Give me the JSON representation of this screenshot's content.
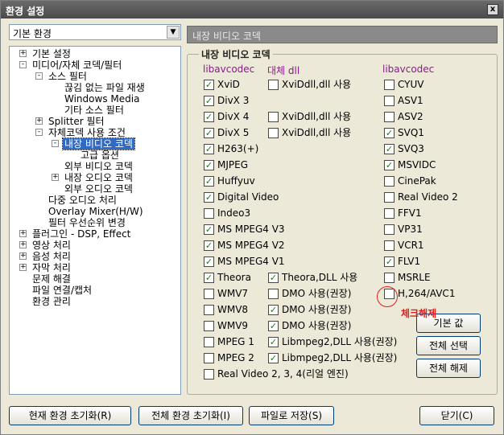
{
  "window": {
    "title": "환경 설정",
    "close_glyph": "x"
  },
  "combo": {
    "value": "기본 환경",
    "arrow_glyph": "▼"
  },
  "tree": [
    {
      "label": "기본 설정",
      "exp": "+"
    },
    {
      "label": "미디어/자체 코덱/필터",
      "exp": "-"
    },
    {
      "label": "소스 필터",
      "exp": "-"
    },
    {
      "label": "끊김 없는 파일 재생",
      "exp": ""
    },
    {
      "label": "Windows Media",
      "exp": ""
    },
    {
      "label": "기타 소스 필터",
      "exp": ""
    },
    {
      "label": "Splitter 필터",
      "exp": "+"
    },
    {
      "label": "자체코덱 사용 조건",
      "exp": "-"
    },
    {
      "label": "내장 비디오 코덱",
      "exp": "-"
    },
    {
      "label": "고급 옵션",
      "exp": ""
    },
    {
      "label": "외부 비디오 코덱",
      "exp": ""
    },
    {
      "label": "내장 오디오 코덱",
      "exp": "+"
    },
    {
      "label": "외부 오디오 코덱",
      "exp": ""
    },
    {
      "label": "다중 오디오 처리",
      "exp": ""
    },
    {
      "label": "Overlay Mixer(H/W)",
      "exp": ""
    },
    {
      "label": "필터 우선순위 변경",
      "exp": ""
    },
    {
      "label": "플러그인 - DSP, Effect",
      "exp": "+"
    },
    {
      "label": "영상 처리",
      "exp": "+"
    },
    {
      "label": "음성 처리",
      "exp": "+"
    },
    {
      "label": "자막 처리",
      "exp": "+"
    },
    {
      "label": "문제 해결",
      "exp": ""
    },
    {
      "label": "파일 연결/캡처",
      "exp": ""
    },
    {
      "label": "환경 관리",
      "exp": ""
    }
  ],
  "panel": {
    "header": "내장 비디오 코덱",
    "group_label": "내장 비디오 코덱",
    "col1_head": "libavcodec",
    "col2_head": "대체 dll",
    "col3_head": "libavcodec"
  },
  "col1": [
    {
      "label": "XviD",
      "checked": true
    },
    {
      "label": "DivX 3",
      "checked": true
    },
    {
      "label": "DivX 4",
      "checked": true
    },
    {
      "label": "DivX 5",
      "checked": true
    },
    {
      "label": "H263(+)",
      "checked": true
    },
    {
      "label": "MJPEG",
      "checked": true
    },
    {
      "label": "Huffyuv",
      "checked": true
    },
    {
      "label": "Digital Video",
      "checked": true
    },
    {
      "label": "Indeo3",
      "checked": false
    },
    {
      "label": "MS MPEG4 V3",
      "checked": true
    },
    {
      "label": "MS MPEG4 V2",
      "checked": true
    },
    {
      "label": "MS MPEG4 V1",
      "checked": true
    },
    {
      "label": "Theora",
      "checked": true
    },
    {
      "label": "WMV7",
      "checked": false
    },
    {
      "label": "WMV8",
      "checked": false
    },
    {
      "label": "WMV9",
      "checked": false
    },
    {
      "label": "MPEG 1",
      "checked": false
    },
    {
      "label": "MPEG 2",
      "checked": false
    },
    {
      "label": "Real Video 2, 3, 4(리얼 엔진)",
      "checked": false
    }
  ],
  "col2": [
    {
      "label": "XviDdll,dll 사용",
      "checked": false,
      "row": 0
    },
    {
      "label": "XviDdll,dll 사용",
      "checked": false,
      "row": 2
    },
    {
      "label": "XviDdll,dll 사용",
      "checked": false,
      "row": 3
    },
    {
      "label": "Theora,DLL 사용",
      "checked": true,
      "row": 12
    },
    {
      "label": "DMO 사용(권장)",
      "checked": false,
      "row": 13
    },
    {
      "label": "DMO 사용(권장)",
      "checked": true,
      "row": 14
    },
    {
      "label": "DMO 사용(권장)",
      "checked": true,
      "row": 15
    },
    {
      "label": "Libmpeg2,DLL 사용(권장)",
      "checked": true,
      "row": 16
    },
    {
      "label": "Libmpeg2,DLL 사용(권장)",
      "checked": true,
      "row": 17
    }
  ],
  "col3": [
    {
      "label": "CYUV",
      "checked": false
    },
    {
      "label": "ASV1",
      "checked": false
    },
    {
      "label": "ASV2",
      "checked": false
    },
    {
      "label": "SVQ1",
      "checked": true
    },
    {
      "label": "SVQ3",
      "checked": true
    },
    {
      "label": "MSVIDC",
      "checked": true
    },
    {
      "label": "CinePak",
      "checked": false
    },
    {
      "label": "Real Video 2",
      "checked": false
    },
    {
      "label": "FFV1",
      "checked": false
    },
    {
      "label": "VP31",
      "checked": false
    },
    {
      "label": "VCR1",
      "checked": false
    },
    {
      "label": "FLV1",
      "checked": true
    },
    {
      "label": "MSRLE",
      "checked": false
    },
    {
      "label": "H,264/AVC1",
      "checked": false
    }
  ],
  "side_buttons": {
    "default": "기본 값",
    "select_all": "전체 선택",
    "deselect_all": "전체 해제"
  },
  "annotation": {
    "text": "체크해제"
  },
  "bottom_buttons": {
    "reset_current": "현재 환경 초기화(R)",
    "reset_all": "전체 환경 초기화(I)",
    "save_file": "파일로 저장(S)",
    "close": "닫기(C)"
  },
  "colors": {
    "column_head": "#8b1a8b",
    "check": "#1a7a1a",
    "annotation": "#e02020",
    "selection": "#316ac5"
  }
}
